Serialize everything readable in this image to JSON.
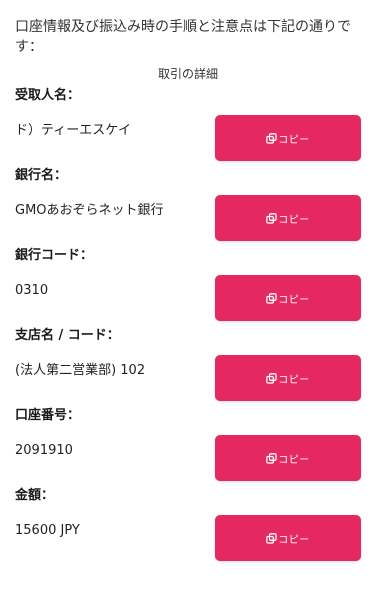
{
  "intro_text": "口座情報及び振込み時の手順と注意点は下記の通りです：",
  "section_title": "取引の詳細",
  "accent_color": "#e5285f",
  "copy_button": {
    "label": "コピー",
    "icon": "copy-icon"
  },
  "fields": [
    {
      "label": "受取人名：",
      "value": "ド）ティーエスケイ"
    },
    {
      "label": "銀行名：",
      "value": "GMOあおぞらネット銀行"
    },
    {
      "label": "銀行コード：",
      "value": "0310"
    },
    {
      "label": "支店名 / コード：",
      "value": "(法人第二営業部) 102"
    },
    {
      "label": "口座番号：",
      "value": "2091910"
    },
    {
      "label": "金額：",
      "value": "15600 JPY"
    }
  ]
}
